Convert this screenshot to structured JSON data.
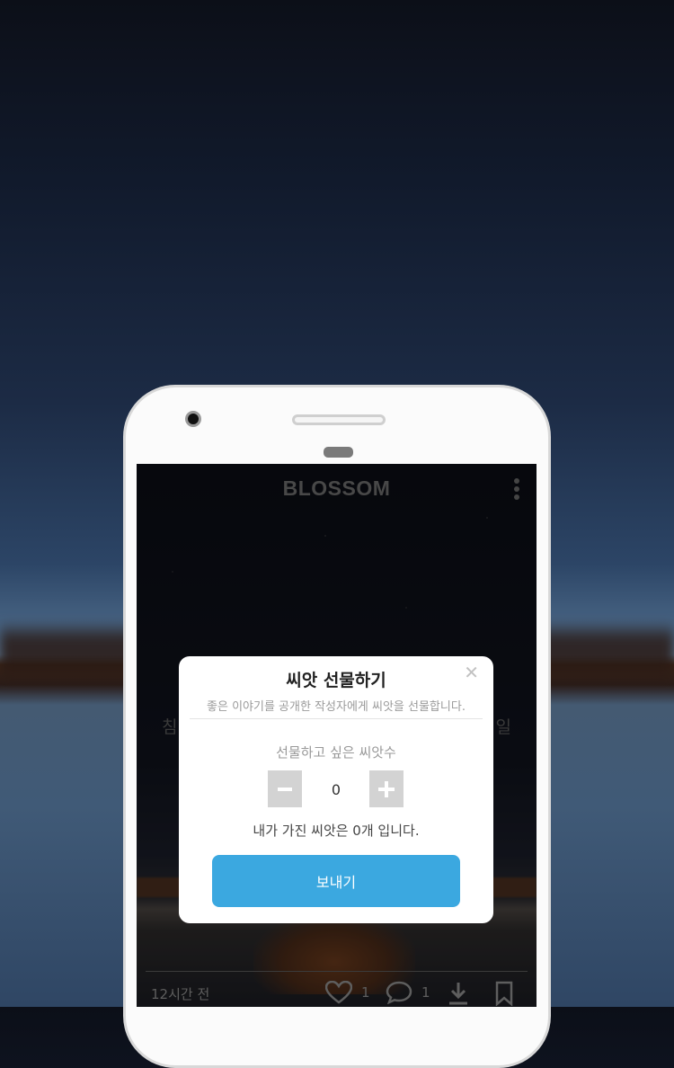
{
  "app": {
    "title": "BLOSSOM"
  },
  "background_text": {
    "left": "침",
    "right": "일"
  },
  "post_footer": {
    "time": "12시간 전",
    "likes": "1",
    "comments": "1"
  },
  "dialog": {
    "title": "씨앗 선물하기",
    "subtitle": "좋은 이야기를 공개한 작성자에게 씨앗을 선물합니다.",
    "quantity_label": "선물하고 싶은 씨앗수",
    "quantity_value": "0",
    "own_seeds_text": "내가 가진 씨앗은 0개 입니다.",
    "send_label": "보내기"
  },
  "colors": {
    "accent": "#3ba8e0",
    "stepper": "#d3d3d3"
  },
  "icons": [
    "more-vertical-icon",
    "close-icon",
    "minus-icon",
    "plus-icon",
    "heart-icon",
    "comment-icon",
    "download-icon",
    "bookmark-icon"
  ]
}
